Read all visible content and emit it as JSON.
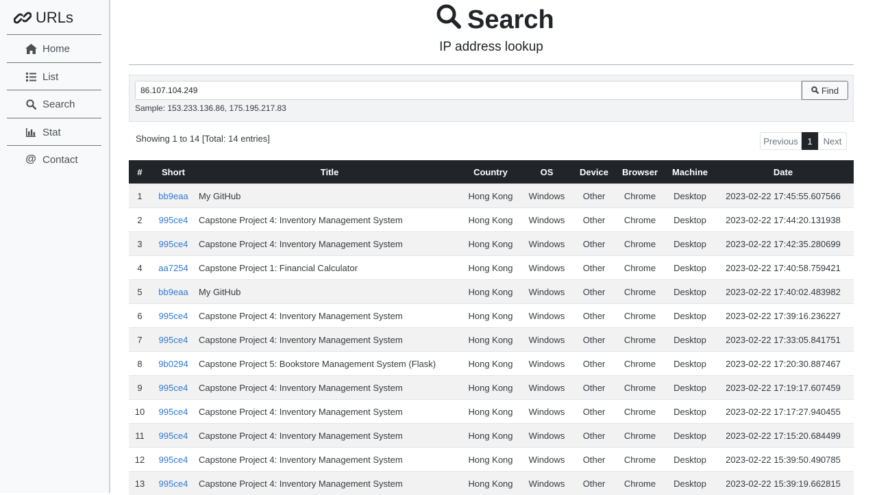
{
  "sidebar": {
    "brand": "URLs",
    "items": [
      {
        "label": "Home",
        "icon": "home-icon"
      },
      {
        "label": "List",
        "icon": "list-icon"
      },
      {
        "label": "Search",
        "icon": "search-icon"
      },
      {
        "label": "Stat",
        "icon": "chart-icon"
      },
      {
        "label": "Contact",
        "icon": "at-icon"
      }
    ]
  },
  "header": {
    "title": "Search",
    "subtitle": "IP address lookup"
  },
  "search": {
    "value": "86.107.104.249",
    "button": "Find",
    "sample": "Sample: 153.233.136.86, 175.195.217.83"
  },
  "info": {
    "showing": "Showing 1 to 14 [Total: 14 entries]"
  },
  "pagination": {
    "previous": "Previous",
    "current": "1",
    "next": "Next"
  },
  "table": {
    "columns": [
      "#",
      "Short",
      "Title",
      "Country",
      "OS",
      "Device",
      "Browser",
      "Machine",
      "Date"
    ],
    "rows": [
      [
        "1",
        "bb9eaa",
        "My GitHub",
        "Hong Kong",
        "Windows",
        "Other",
        "Chrome",
        "Desktop",
        "2023-02-22 17:45:55.607566"
      ],
      [
        "2",
        "995ce4",
        "Capstone Project 4: Inventory Management System",
        "Hong Kong",
        "Windows",
        "Other",
        "Chrome",
        "Desktop",
        "2023-02-22 17:44:20.131938"
      ],
      [
        "3",
        "995ce4",
        "Capstone Project 4: Inventory Management System",
        "Hong Kong",
        "Windows",
        "Other",
        "Chrome",
        "Desktop",
        "2023-02-22 17:42:35.280699"
      ],
      [
        "4",
        "aa7254",
        "Capstone Project 1: Financial Calculator",
        "Hong Kong",
        "Windows",
        "Other",
        "Chrome",
        "Desktop",
        "2023-02-22 17:40:58.759421"
      ],
      [
        "5",
        "bb9eaa",
        "My GitHub",
        "Hong Kong",
        "Windows",
        "Other",
        "Chrome",
        "Desktop",
        "2023-02-22 17:40:02.483982"
      ],
      [
        "6",
        "995ce4",
        "Capstone Project 4: Inventory Management System",
        "Hong Kong",
        "Windows",
        "Other",
        "Chrome",
        "Desktop",
        "2023-02-22 17:39:16.236227"
      ],
      [
        "7",
        "995ce4",
        "Capstone Project 4: Inventory Management System",
        "Hong Kong",
        "Windows",
        "Other",
        "Chrome",
        "Desktop",
        "2023-02-22 17:33:05.841751"
      ],
      [
        "8",
        "9b0294",
        "Capstone Project 5: Bookstore Management System (Flask)",
        "Hong Kong",
        "Windows",
        "Other",
        "Chrome",
        "Desktop",
        "2023-02-22 17:20:30.887467"
      ],
      [
        "9",
        "995ce4",
        "Capstone Project 4: Inventory Management System",
        "Hong Kong",
        "Windows",
        "Other",
        "Chrome",
        "Desktop",
        "2023-02-22 17:19:17.607459"
      ],
      [
        "10",
        "995ce4",
        "Capstone Project 4: Inventory Management System",
        "Hong Kong",
        "Windows",
        "Other",
        "Chrome",
        "Desktop",
        "2023-02-22 17:17:27.940455"
      ],
      [
        "11",
        "995ce4",
        "Capstone Project 4: Inventory Management System",
        "Hong Kong",
        "Windows",
        "Other",
        "Chrome",
        "Desktop",
        "2023-02-22 17:15:20.684499"
      ],
      [
        "12",
        "995ce4",
        "Capstone Project 4: Inventory Management System",
        "Hong Kong",
        "Windows",
        "Other",
        "Chrome",
        "Desktop",
        "2023-02-22 15:39:50.490785"
      ],
      [
        "13",
        "995ce4",
        "Capstone Project 4: Inventory Management System",
        "Hong Kong",
        "Windows",
        "Other",
        "Chrome",
        "Desktop",
        "2023-02-22 15:39:19.662815"
      ]
    ]
  },
  "colors": {
    "header_bg": "#212529",
    "link": "#2f79d6",
    "stripe": "#f2f2f2",
    "sidebar_bg": "#f8f9fa"
  }
}
